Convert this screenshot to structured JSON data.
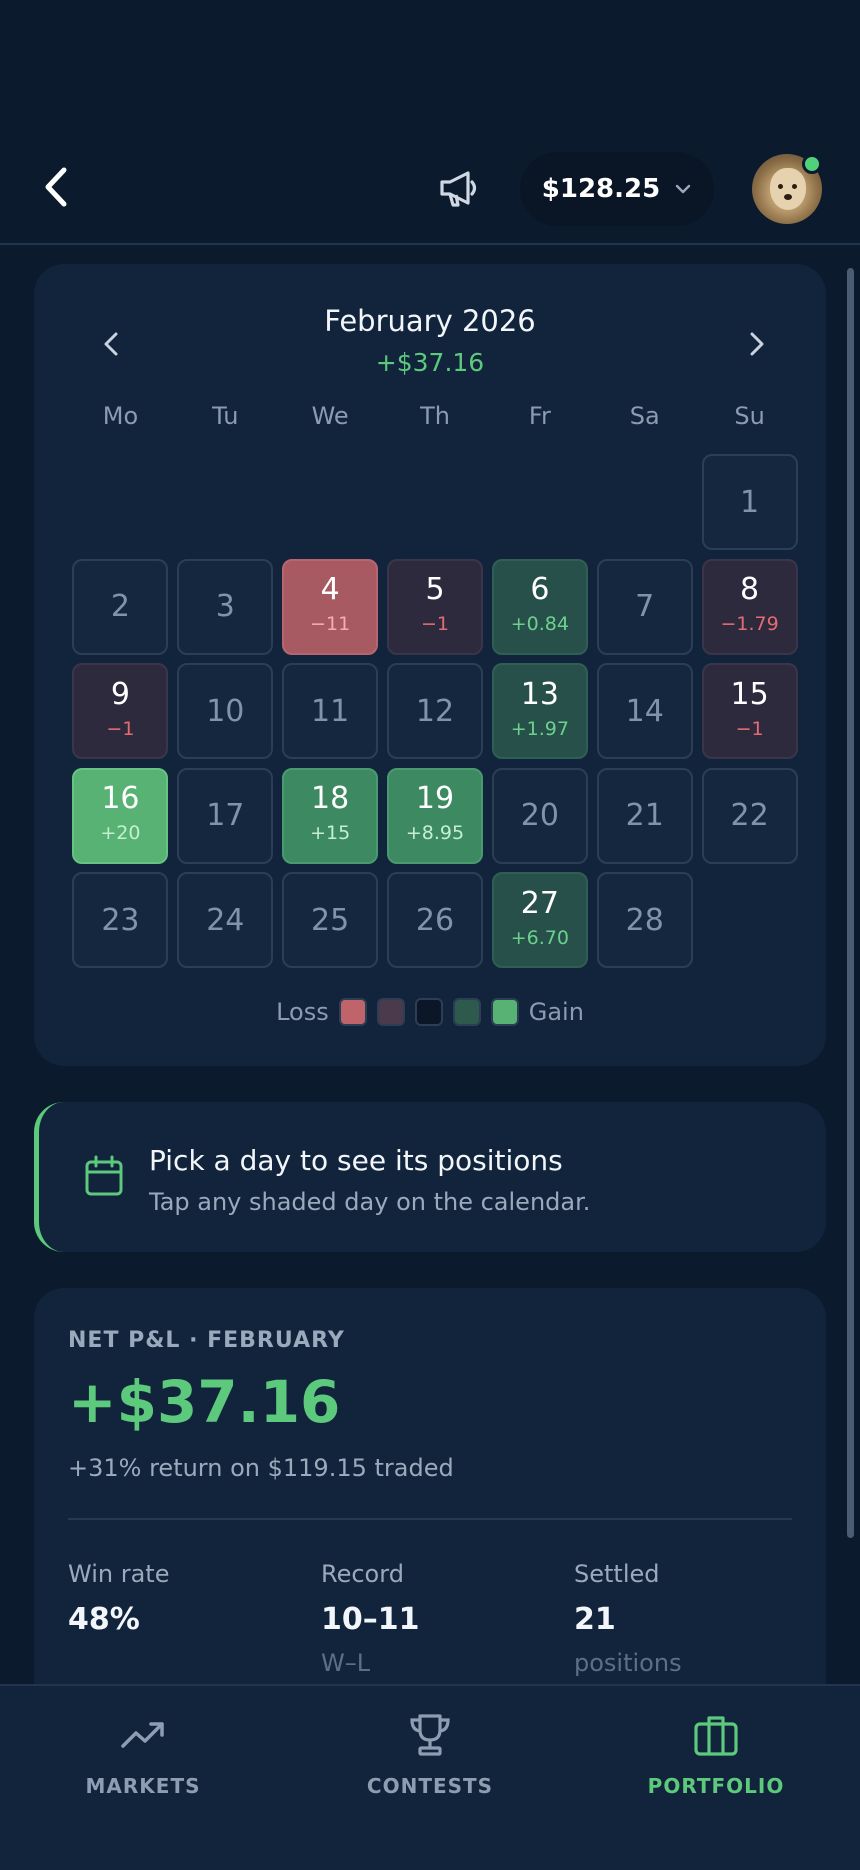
{
  "header": {
    "balance": "$128.25",
    "icons": [
      "back-arrow-icon",
      "megaphone-icon",
      "chevron-down-icon",
      "avatar"
    ]
  },
  "calendar": {
    "month_title": "February 2026",
    "month_total": "+$37.16",
    "weekdays": [
      "Mo",
      "Tu",
      "We",
      "Th",
      "Fr",
      "Sa",
      "Su"
    ],
    "days": [
      {
        "day": "1",
        "value": "",
        "level": "none"
      },
      {
        "day": "2",
        "value": "",
        "level": "none"
      },
      {
        "day": "3",
        "value": "",
        "level": "none"
      },
      {
        "day": "4",
        "value": "−11",
        "level": "loss-strong"
      },
      {
        "day": "5",
        "value": "−1",
        "level": "loss-weak"
      },
      {
        "day": "6",
        "value": "+0.84",
        "level": "gain-weak"
      },
      {
        "day": "7",
        "value": "",
        "level": "none"
      },
      {
        "day": "8",
        "value": "−1.79",
        "level": "loss-weak"
      },
      {
        "day": "9",
        "value": "−1",
        "level": "loss-weak"
      },
      {
        "day": "10",
        "value": "",
        "level": "none"
      },
      {
        "day": "11",
        "value": "",
        "level": "none"
      },
      {
        "day": "12",
        "value": "",
        "level": "none"
      },
      {
        "day": "13",
        "value": "+1.97",
        "level": "gain-weak"
      },
      {
        "day": "14",
        "value": "",
        "level": "none"
      },
      {
        "day": "15",
        "value": "−1",
        "level": "loss-weak"
      },
      {
        "day": "16",
        "value": "+20",
        "level": "gain-strong"
      },
      {
        "day": "17",
        "value": "",
        "level": "none"
      },
      {
        "day": "18",
        "value": "+15",
        "level": "gain-mid"
      },
      {
        "day": "19",
        "value": "+8.95",
        "level": "gain-mid"
      },
      {
        "day": "20",
        "value": "",
        "level": "none"
      },
      {
        "day": "21",
        "value": "",
        "level": "none"
      },
      {
        "day": "22",
        "value": "",
        "level": "none"
      },
      {
        "day": "23",
        "value": "",
        "level": "none"
      },
      {
        "day": "24",
        "value": "",
        "level": "none"
      },
      {
        "day": "25",
        "value": "",
        "level": "none"
      },
      {
        "day": "26",
        "value": "",
        "level": "none"
      },
      {
        "day": "27",
        "value": "+6.70",
        "level": "gain-weak"
      },
      {
        "day": "28",
        "value": "",
        "level": "none"
      }
    ],
    "first_weekday_index": 6,
    "legend": {
      "loss_label": "Loss",
      "gain_label": "Gain",
      "swatches": [
        "#c0646b",
        "#4a3a4c",
        "#0b1626",
        "#2e5a4d",
        "#58b273"
      ]
    }
  },
  "hint": {
    "title": "Pick a day to see its positions",
    "subtitle": "Tap any shaded day on the calendar."
  },
  "pnl": {
    "eyebrow": "NET P&L · FEBRUARY",
    "amount": "+$37.16",
    "subtitle": "+31% return on $119.15 traded",
    "stats": [
      {
        "label": "Win rate",
        "value": "48%",
        "unit": ""
      },
      {
        "label": "Record",
        "value": "10–11",
        "unit": "W–L"
      },
      {
        "label": "Settled",
        "value": "21",
        "unit": "positions"
      }
    ]
  },
  "bottom_nav": {
    "tabs": [
      {
        "label": "MARKETS",
        "icon": "trending-up-icon",
        "active": false
      },
      {
        "label": "CONTESTS",
        "icon": "trophy-icon",
        "active": false
      },
      {
        "label": "PORTFOLIO",
        "icon": "briefcase-icon",
        "active": true
      }
    ]
  },
  "colors": {
    "background": "#0b1a2c",
    "card": "#12243b",
    "gain": "#5cc97d",
    "loss": "#e46b72"
  }
}
